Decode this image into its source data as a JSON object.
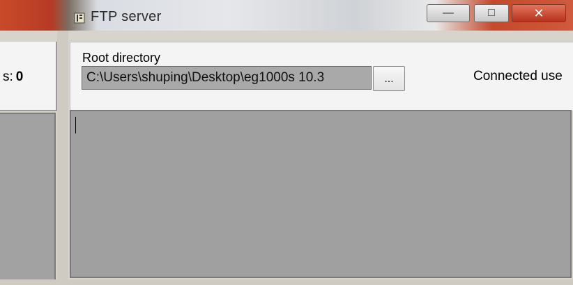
{
  "window": {
    "title": "FTP server",
    "icon": "ftp-server-app-icon",
    "controls": {
      "minimize": "minimize-icon",
      "maximize": "maximize-icon",
      "close": "close-icon"
    }
  },
  "stats": {
    "label": "s:",
    "value": "0"
  },
  "settings": {
    "root_label": "Root directory",
    "root_path": "C:\\Users\\shuping\\Desktop\\eg1000s 10.3",
    "browse_label": "...",
    "connected_label": "Connected use"
  },
  "log": {
    "text": ""
  },
  "colors": {
    "titlebar_accent": "#c94a2a",
    "panel_background": "#f4f4f4",
    "log_background": "#a0a0a0"
  }
}
